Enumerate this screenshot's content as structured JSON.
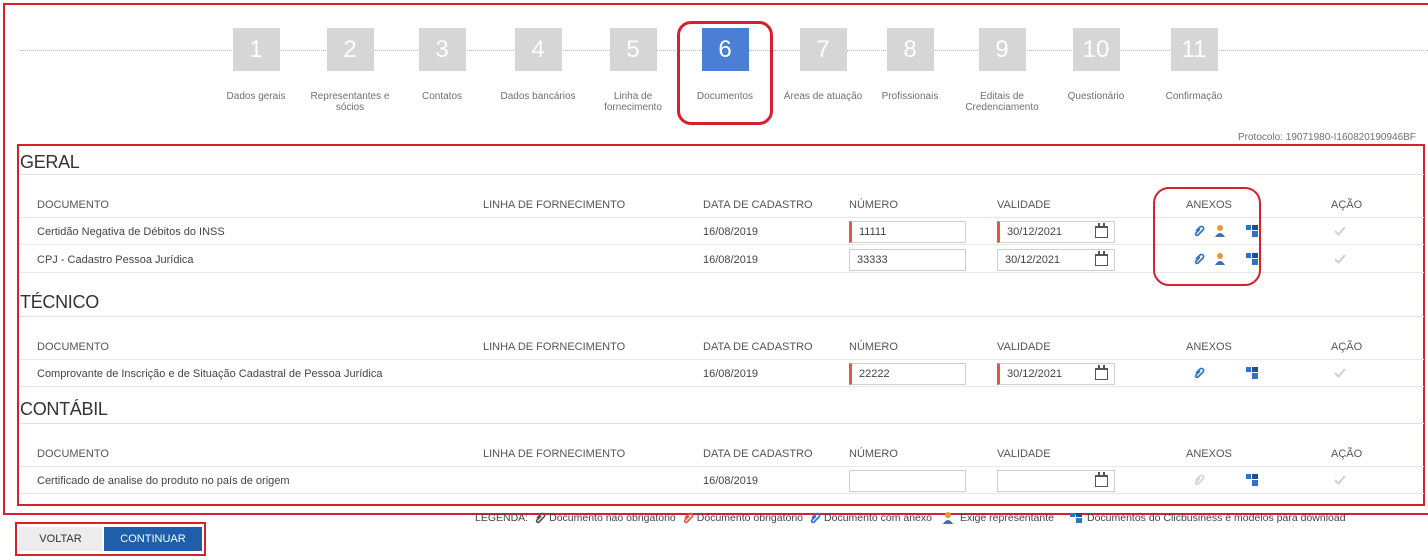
{
  "wizard": {
    "steps": [
      {
        "number": "1",
        "label": "Dados gerais"
      },
      {
        "number": "2",
        "label": "Representantes e sócios"
      },
      {
        "number": "3",
        "label": "Contatos"
      },
      {
        "number": "4",
        "label": "Dados bancários"
      },
      {
        "number": "5",
        "label": "Linha de fornecimento"
      },
      {
        "number": "6",
        "label": "Documentos"
      },
      {
        "number": "7",
        "label": "Áreas de atuação"
      },
      {
        "number": "8",
        "label": "Profissionais"
      },
      {
        "number": "9",
        "label": "Editais de Credenciamento"
      },
      {
        "number": "10",
        "label": "Questionário"
      },
      {
        "number": "11",
        "label": "Confirmação"
      }
    ],
    "active_step": "6",
    "protocol": "Protocolo: 19071980-I160820190946BF"
  },
  "columns": {
    "documento": "DOCUMENTO",
    "linha": "LINHA DE FORNECIMENTO",
    "data": "DATA DE CADASTRO",
    "numero": "NÚMERO",
    "validade": "VALIDADE",
    "anexos": "ANEXOS",
    "acao": "AÇÃO"
  },
  "sections": {
    "geral": {
      "title": "GERAL",
      "rows": [
        {
          "documento": "Certidão Negativa de Débitos do INSS",
          "data": "16/08/2019",
          "numero": "11111",
          "validade": "30/12/2021"
        },
        {
          "documento": "CPJ - Cadastro Pessoa Jurídica",
          "data": "16/08/2019",
          "numero": "33333",
          "validade": "30/12/2021"
        }
      ]
    },
    "tecnico": {
      "title": "TÉCNICO",
      "rows": [
        {
          "documento": "Comprovante de Inscrição e de Situação Cadastral de Pessoa Jurídica",
          "data": "16/08/2019",
          "numero": "22222",
          "validade": "30/12/2021"
        }
      ]
    },
    "contabil": {
      "title": "CONTÁBIL",
      "rows": [
        {
          "documento": "Certificado de analise do produto no país de origem",
          "data": "16/08/2019",
          "numero": "",
          "validade": ""
        }
      ]
    }
  },
  "legend": {
    "label": "LEGENDA:",
    "nao_obrigatorio": "Documento não obrigatório",
    "obrigatorio": "Documento obrigatório",
    "com_anexo": "Documento com anexo",
    "representante": "Exige representante",
    "clicbusiness": "Documentos do Clicbusiness e modelos para download"
  },
  "buttons": {
    "back": "VOLTAR",
    "next": "CONTINUAR"
  },
  "colors": {
    "highlight": "#d6202e",
    "active_step": "#4a7fd3",
    "inactive_step": "#d6d6d6",
    "primary_button": "#1f5ea8",
    "required_marker": "#e0593e",
    "clip_attached": "#2d74c9",
    "clip_required": "#e0593e",
    "clip_optional": "#555555"
  },
  "icons": {
    "attachment": "paperclip-icon",
    "representative": "person-icon",
    "clicbusiness": "clicbusiness-icon",
    "calendar": "calendar-icon",
    "action": "check-icon"
  }
}
